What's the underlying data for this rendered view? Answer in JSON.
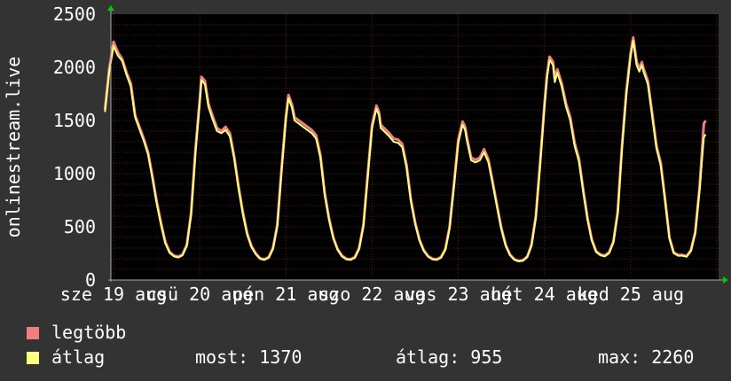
{
  "chart_data": {
    "type": "line",
    "ylabel": "onlinestream.live",
    "ylim": [
      0,
      2500
    ],
    "yticks": [
      0,
      500,
      1000,
      1500,
      2000,
      2500
    ],
    "ytick_labels": [
      "0",
      "500",
      "1000",
      "1500",
      "2000",
      "2500"
    ],
    "xlim": [
      0,
      8.2
    ],
    "xtick_labels": [
      {
        "day": 0,
        "text": "sze 19 aug"
      },
      {
        "day": 1,
        "text": "csü 20 aug"
      },
      {
        "day": 2,
        "text": "pén 21 aug"
      },
      {
        "day": 3,
        "text": "szo 22 aug"
      },
      {
        "day": 4,
        "text": "vas 23 aug"
      },
      {
        "day": 5,
        "text": "hét 24 aug"
      },
      {
        "day": 6,
        "text": "ked 25 aug"
      }
    ],
    "grid": true,
    "colors": {
      "background": "#333333",
      "plot_bg": "#000000",
      "grid": "#5a1a1a",
      "max_series": "#f08080",
      "avg_series": "#ffff80",
      "axis": "#aaaaaa",
      "arrow": "#00cc00"
    },
    "series": [
      {
        "name": "legtöbb",
        "color": "#f08080",
        "points": [
          [
            -0.1,
            1600
          ],
          [
            -0.05,
            1980
          ],
          [
            0.0,
            2240
          ],
          [
            0.05,
            2140
          ],
          [
            0.1,
            2080
          ],
          [
            0.15,
            1950
          ],
          [
            0.2,
            1850
          ],
          [
            0.25,
            1550
          ],
          [
            0.3,
            1440
          ],
          [
            0.35,
            1330
          ],
          [
            0.4,
            1200
          ],
          [
            0.45,
            980
          ],
          [
            0.5,
            740
          ],
          [
            0.55,
            540
          ],
          [
            0.6,
            360
          ],
          [
            0.65,
            265
          ],
          [
            0.7,
            230
          ],
          [
            0.75,
            220
          ],
          [
            0.8,
            240
          ],
          [
            0.85,
            330
          ],
          [
            0.9,
            630
          ],
          [
            0.95,
            1220
          ],
          [
            1.0,
            1690
          ],
          [
            1.02,
            1910
          ],
          [
            1.06,
            1870
          ],
          [
            1.1,
            1660
          ],
          [
            1.15,
            1540
          ],
          [
            1.2,
            1430
          ],
          [
            1.25,
            1400
          ],
          [
            1.3,
            1440
          ],
          [
            1.35,
            1380
          ],
          [
            1.4,
            1160
          ],
          [
            1.45,
            880
          ],
          [
            1.5,
            640
          ],
          [
            1.55,
            440
          ],
          [
            1.6,
            320
          ],
          [
            1.65,
            250
          ],
          [
            1.7,
            205
          ],
          [
            1.75,
            195
          ],
          [
            1.8,
            215
          ],
          [
            1.85,
            300
          ],
          [
            1.9,
            520
          ],
          [
            1.95,
            1050
          ],
          [
            2.0,
            1540
          ],
          [
            2.03,
            1740
          ],
          [
            2.07,
            1650
          ],
          [
            2.1,
            1530
          ],
          [
            2.15,
            1500
          ],
          [
            2.2,
            1470
          ],
          [
            2.25,
            1440
          ],
          [
            2.3,
            1410
          ],
          [
            2.35,
            1360
          ],
          [
            2.4,
            1180
          ],
          [
            2.45,
            820
          ],
          [
            2.5,
            580
          ],
          [
            2.55,
            400
          ],
          [
            2.6,
            290
          ],
          [
            2.65,
            230
          ],
          [
            2.7,
            200
          ],
          [
            2.75,
            195
          ],
          [
            2.8,
            215
          ],
          [
            2.85,
            300
          ],
          [
            2.9,
            520
          ],
          [
            2.95,
            1000
          ],
          [
            3.0,
            1460
          ],
          [
            3.05,
            1640
          ],
          [
            3.08,
            1580
          ],
          [
            3.1,
            1460
          ],
          [
            3.15,
            1420
          ],
          [
            3.2,
            1380
          ],
          [
            3.25,
            1330
          ],
          [
            3.3,
            1320
          ],
          [
            3.35,
            1280
          ],
          [
            3.4,
            1080
          ],
          [
            3.45,
            760
          ],
          [
            3.5,
            540
          ],
          [
            3.55,
            380
          ],
          [
            3.6,
            280
          ],
          [
            3.65,
            225
          ],
          [
            3.7,
            200
          ],
          [
            3.75,
            195
          ],
          [
            3.8,
            215
          ],
          [
            3.85,
            290
          ],
          [
            3.9,
            500
          ],
          [
            3.95,
            900
          ],
          [
            4.0,
            1320
          ],
          [
            4.05,
            1490
          ],
          [
            4.08,
            1440
          ],
          [
            4.1,
            1340
          ],
          [
            4.15,
            1150
          ],
          [
            4.2,
            1130
          ],
          [
            4.25,
            1150
          ],
          [
            4.3,
            1230
          ],
          [
            4.35,
            1130
          ],
          [
            4.4,
            920
          ],
          [
            4.45,
            700
          ],
          [
            4.5,
            490
          ],
          [
            4.55,
            330
          ],
          [
            4.6,
            240
          ],
          [
            4.65,
            195
          ],
          [
            4.7,
            180
          ],
          [
            4.75,
            185
          ],
          [
            4.8,
            220
          ],
          [
            4.85,
            330
          ],
          [
            4.9,
            600
          ],
          [
            4.95,
            1100
          ],
          [
            5.0,
            1650
          ],
          [
            5.03,
            1930
          ],
          [
            5.06,
            2100
          ],
          [
            5.1,
            2050
          ],
          [
            5.12,
            1890
          ],
          [
            5.15,
            1980
          ],
          [
            5.2,
            1850
          ],
          [
            5.25,
            1660
          ],
          [
            5.3,
            1530
          ],
          [
            5.35,
            1290
          ],
          [
            5.4,
            1140
          ],
          [
            5.45,
            850
          ],
          [
            5.5,
            580
          ],
          [
            5.55,
            380
          ],
          [
            5.6,
            270
          ],
          [
            5.65,
            240
          ],
          [
            5.7,
            230
          ],
          [
            5.75,
            260
          ],
          [
            5.8,
            360
          ],
          [
            5.85,
            640
          ],
          [
            5.9,
            1260
          ],
          [
            5.95,
            1770
          ],
          [
            6.0,
            2130
          ],
          [
            6.03,
            2280
          ],
          [
            6.07,
            2050
          ],
          [
            6.1,
            1990
          ],
          [
            6.13,
            2050
          ],
          [
            6.15,
            1990
          ],
          [
            6.2,
            1870
          ],
          [
            6.25,
            1570
          ],
          [
            6.3,
            1260
          ],
          [
            6.35,
            1100
          ],
          [
            6.4,
            760
          ],
          [
            6.45,
            400
          ],
          [
            6.5,
            260
          ],
          [
            6.55,
            235
          ],
          [
            6.6,
            235
          ],
          [
            6.65,
            225
          ],
          [
            6.7,
            280
          ],
          [
            6.75,
            450
          ],
          [
            6.8,
            870
          ],
          [
            6.85,
            1470
          ],
          [
            6.87,
            1500
          ]
        ]
      },
      {
        "name": "átlag",
        "color": "#ffff80",
        "points": [
          [
            -0.1,
            1580
          ],
          [
            -0.05,
            1960
          ],
          [
            0.0,
            2200
          ],
          [
            0.05,
            2110
          ],
          [
            0.1,
            2060
          ],
          [
            0.15,
            1930
          ],
          [
            0.2,
            1820
          ],
          [
            0.25,
            1530
          ],
          [
            0.3,
            1420
          ],
          [
            0.35,
            1310
          ],
          [
            0.4,
            1180
          ],
          [
            0.45,
            960
          ],
          [
            0.5,
            720
          ],
          [
            0.55,
            520
          ],
          [
            0.6,
            345
          ],
          [
            0.65,
            255
          ],
          [
            0.7,
            222
          ],
          [
            0.75,
            212
          ],
          [
            0.8,
            232
          ],
          [
            0.85,
            320
          ],
          [
            0.9,
            610
          ],
          [
            0.95,
            1190
          ],
          [
            1.0,
            1660
          ],
          [
            1.02,
            1880
          ],
          [
            1.06,
            1840
          ],
          [
            1.1,
            1630
          ],
          [
            1.15,
            1510
          ],
          [
            1.2,
            1400
          ],
          [
            1.25,
            1380
          ],
          [
            1.3,
            1410
          ],
          [
            1.35,
            1350
          ],
          [
            1.4,
            1140
          ],
          [
            1.45,
            860
          ],
          [
            1.5,
            620
          ],
          [
            1.55,
            425
          ],
          [
            1.6,
            310
          ],
          [
            1.65,
            242
          ],
          [
            1.7,
            198
          ],
          [
            1.75,
            188
          ],
          [
            1.8,
            208
          ],
          [
            1.85,
            290
          ],
          [
            1.9,
            505
          ],
          [
            1.95,
            1020
          ],
          [
            2.0,
            1510
          ],
          [
            2.03,
            1710
          ],
          [
            2.07,
            1620
          ],
          [
            2.1,
            1500
          ],
          [
            2.15,
            1470
          ],
          [
            2.2,
            1440
          ],
          [
            2.25,
            1410
          ],
          [
            2.3,
            1380
          ],
          [
            2.35,
            1330
          ],
          [
            2.4,
            1150
          ],
          [
            2.45,
            800
          ],
          [
            2.5,
            565
          ],
          [
            2.55,
            390
          ],
          [
            2.6,
            282
          ],
          [
            2.65,
            222
          ],
          [
            2.7,
            194
          ],
          [
            2.75,
            188
          ],
          [
            2.8,
            208
          ],
          [
            2.85,
            290
          ],
          [
            2.9,
            505
          ],
          [
            2.95,
            975
          ],
          [
            3.0,
            1430
          ],
          [
            3.05,
            1610
          ],
          [
            3.08,
            1550
          ],
          [
            3.1,
            1430
          ],
          [
            3.15,
            1390
          ],
          [
            3.2,
            1350
          ],
          [
            3.25,
            1300
          ],
          [
            3.3,
            1290
          ],
          [
            3.35,
            1250
          ],
          [
            3.4,
            1055
          ],
          [
            3.45,
            740
          ],
          [
            3.5,
            525
          ],
          [
            3.55,
            370
          ],
          [
            3.6,
            272
          ],
          [
            3.65,
            218
          ],
          [
            3.7,
            194
          ],
          [
            3.75,
            188
          ],
          [
            3.8,
            208
          ],
          [
            3.85,
            282
          ],
          [
            3.9,
            485
          ],
          [
            3.95,
            875
          ],
          [
            4.0,
            1290
          ],
          [
            4.05,
            1460
          ],
          [
            4.08,
            1410
          ],
          [
            4.1,
            1310
          ],
          [
            4.15,
            1125
          ],
          [
            4.2,
            1105
          ],
          [
            4.25,
            1125
          ],
          [
            4.3,
            1200
          ],
          [
            4.35,
            1105
          ],
          [
            4.4,
            900
          ],
          [
            4.45,
            685
          ],
          [
            4.5,
            478
          ],
          [
            4.55,
            322
          ],
          [
            4.6,
            233
          ],
          [
            4.65,
            190
          ],
          [
            4.7,
            175
          ],
          [
            4.75,
            180
          ],
          [
            4.8,
            214
          ],
          [
            4.85,
            322
          ],
          [
            4.9,
            585
          ],
          [
            4.95,
            1075
          ],
          [
            5.0,
            1620
          ],
          [
            5.03,
            1900
          ],
          [
            5.06,
            2070
          ],
          [
            5.1,
            2020
          ],
          [
            5.12,
            1860
          ],
          [
            5.15,
            1950
          ],
          [
            5.2,
            1820
          ],
          [
            5.25,
            1630
          ],
          [
            5.3,
            1500
          ],
          [
            5.35,
            1260
          ],
          [
            5.4,
            1115
          ],
          [
            5.45,
            830
          ],
          [
            5.5,
            565
          ],
          [
            5.55,
            370
          ],
          [
            5.6,
            262
          ],
          [
            5.65,
            232
          ],
          [
            5.7,
            222
          ],
          [
            5.75,
            252
          ],
          [
            5.8,
            350
          ],
          [
            5.85,
            625
          ],
          [
            5.9,
            1230
          ],
          [
            5.95,
            1740
          ],
          [
            6.0,
            2100
          ],
          [
            6.03,
            2250
          ],
          [
            6.07,
            2020
          ],
          [
            6.1,
            1960
          ],
          [
            6.13,
            2020
          ],
          [
            6.15,
            1960
          ],
          [
            6.2,
            1840
          ],
          [
            6.25,
            1540
          ],
          [
            6.3,
            1235
          ],
          [
            6.35,
            1075
          ],
          [
            6.4,
            740
          ],
          [
            6.45,
            390
          ],
          [
            6.5,
            252
          ],
          [
            6.55,
            228
          ],
          [
            6.6,
            228
          ],
          [
            6.65,
            218
          ],
          [
            6.7,
            272
          ],
          [
            6.75,
            438
          ],
          [
            6.8,
            850
          ],
          [
            6.85,
            1340
          ],
          [
            6.87,
            1370
          ]
        ]
      }
    ]
  },
  "legend": {
    "max_label": "legtöbb",
    "avg_label": "átlag",
    "now_stat": "most: 1370",
    "avg_stat": "átlag: 955",
    "max_stat": "max: 2260"
  }
}
